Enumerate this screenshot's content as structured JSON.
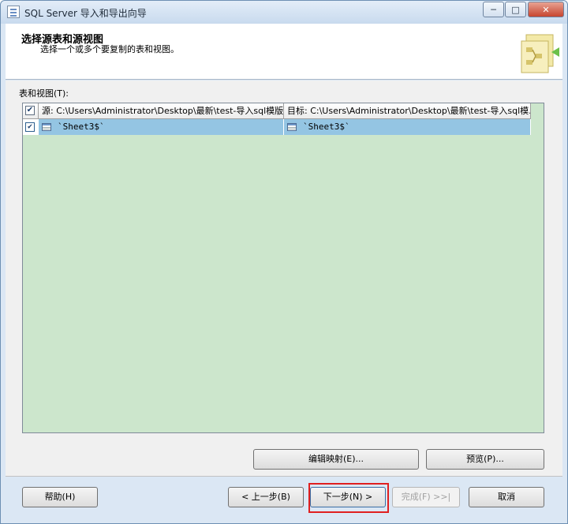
{
  "window": {
    "title": "SQL Server 导入和导出向导",
    "buttons": {
      "minimize": "─",
      "maximize": "□",
      "close": "✕"
    }
  },
  "header": {
    "title": "选择源表和源视图",
    "subtitle": "选择一个或多个要复制的表和视图。"
  },
  "tables": {
    "label": "表和视图(T):",
    "columns": {
      "source": "源: C:\\Users\\Administrator\\Desktop\\最新\\test-导入sql模版....",
      "destination": "目标: C:\\Users\\Administrator\\Desktop\\最新\\test-导入sql模..."
    },
    "rows": [
      {
        "checked": true,
        "source": "`Sheet3$`",
        "destination": "`Sheet3$`"
      }
    ],
    "header_checked": true,
    "check_glyph": "✔"
  },
  "actions": {
    "edit_mappings": "编辑映射(E)...",
    "preview": "预览(P)..."
  },
  "nav": {
    "help": "帮助(H)",
    "back": "< 上一步(B)",
    "next": "下一步(N) >",
    "finish": "完成(F) >>|",
    "cancel": "取消"
  },
  "colors": {
    "grid_background": "#cce6cc",
    "selected_row": "#94c5e3",
    "highlight_border": "#e02020"
  }
}
